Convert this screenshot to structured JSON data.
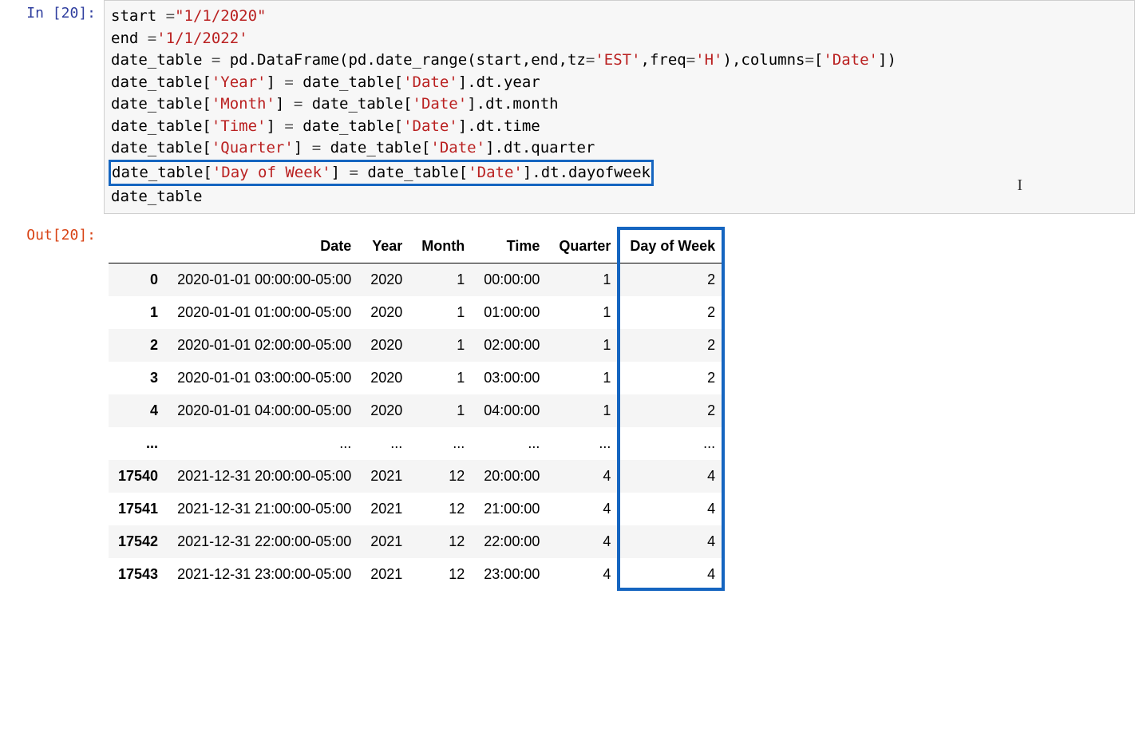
{
  "prompt_in": "In [20]:",
  "prompt_out": "Out[20]:",
  "code": {
    "l1a": "start ",
    "l1b": "=",
    "l1c": "\"1/1/2020\"",
    "l2a": "end ",
    "l2b": "=",
    "l2c": "'1/1/2022'",
    "l3a": "date_table ",
    "l3b": "=",
    "l3c": " pd.DataFrame(pd.date_range(start,end,tz",
    "l3d": "=",
    "l3e": "'EST'",
    "l3f": ",freq",
    "l3g": "=",
    "l3h": "'H'",
    "l3i": "),columns",
    "l3j": "=",
    "l3k": "[",
    "l3l": "'Date'",
    "l3m": "])",
    "l4a": "date_table[",
    "l4b": "'Year'",
    "l4c": "] ",
    "l4d": "=",
    "l4e": " date_table[",
    "l4f": "'Date'",
    "l4g": "].dt.year",
    "l5a": "date_table[",
    "l5b": "'Month'",
    "l5c": "] ",
    "l5d": "=",
    "l5e": " date_table[",
    "l5f": "'Date'",
    "l5g": "].dt.month",
    "l6a": "date_table[",
    "l6b": "'Time'",
    "l6c": "] ",
    "l6d": "=",
    "l6e": " date_table[",
    "l6f": "'Date'",
    "l6g": "].dt.time",
    "l7a": "date_table[",
    "l7b": "'Quarter'",
    "l7c": "] ",
    "l7d": "=",
    "l7e": " date_table[",
    "l7f": "'Date'",
    "l7g": "].dt.quarter",
    "l8a": "date_table[",
    "l8b": "'Day of Week'",
    "l8c": "] ",
    "l8d": "=",
    "l8e": " date_table[",
    "l8f": "'Date'",
    "l8g": "].dt.dayofweek",
    "l9": "date_table"
  },
  "table": {
    "headers": [
      "",
      "Date",
      "Year",
      "Month",
      "Time",
      "Quarter",
      "Day of Week"
    ],
    "rows": [
      {
        "idx": "0",
        "Date": "2020-01-01 00:00:00-05:00",
        "Year": "2020",
        "Month": "1",
        "Time": "00:00:00",
        "Quarter": "1",
        "DayOfWeek": "2"
      },
      {
        "idx": "1",
        "Date": "2020-01-01 01:00:00-05:00",
        "Year": "2020",
        "Month": "1",
        "Time": "01:00:00",
        "Quarter": "1",
        "DayOfWeek": "2"
      },
      {
        "idx": "2",
        "Date": "2020-01-01 02:00:00-05:00",
        "Year": "2020",
        "Month": "1",
        "Time": "02:00:00",
        "Quarter": "1",
        "DayOfWeek": "2"
      },
      {
        "idx": "3",
        "Date": "2020-01-01 03:00:00-05:00",
        "Year": "2020",
        "Month": "1",
        "Time": "03:00:00",
        "Quarter": "1",
        "DayOfWeek": "2"
      },
      {
        "idx": "4",
        "Date": "2020-01-01 04:00:00-05:00",
        "Year": "2020",
        "Month": "1",
        "Time": "04:00:00",
        "Quarter": "1",
        "DayOfWeek": "2"
      },
      {
        "idx": "...",
        "Date": "...",
        "Year": "...",
        "Month": "...",
        "Time": "...",
        "Quarter": "...",
        "DayOfWeek": "..."
      },
      {
        "idx": "17540",
        "Date": "2021-12-31 20:00:00-05:00",
        "Year": "2021",
        "Month": "12",
        "Time": "20:00:00",
        "Quarter": "4",
        "DayOfWeek": "4"
      },
      {
        "idx": "17541",
        "Date": "2021-12-31 21:00:00-05:00",
        "Year": "2021",
        "Month": "12",
        "Time": "21:00:00",
        "Quarter": "4",
        "DayOfWeek": "4"
      },
      {
        "idx": "17542",
        "Date": "2021-12-31 22:00:00-05:00",
        "Year": "2021",
        "Month": "12",
        "Time": "22:00:00",
        "Quarter": "4",
        "DayOfWeek": "4"
      },
      {
        "idx": "17543",
        "Date": "2021-12-31 23:00:00-05:00",
        "Year": "2021",
        "Month": "12",
        "Time": "23:00:00",
        "Quarter": "4",
        "DayOfWeek": "4"
      }
    ]
  }
}
